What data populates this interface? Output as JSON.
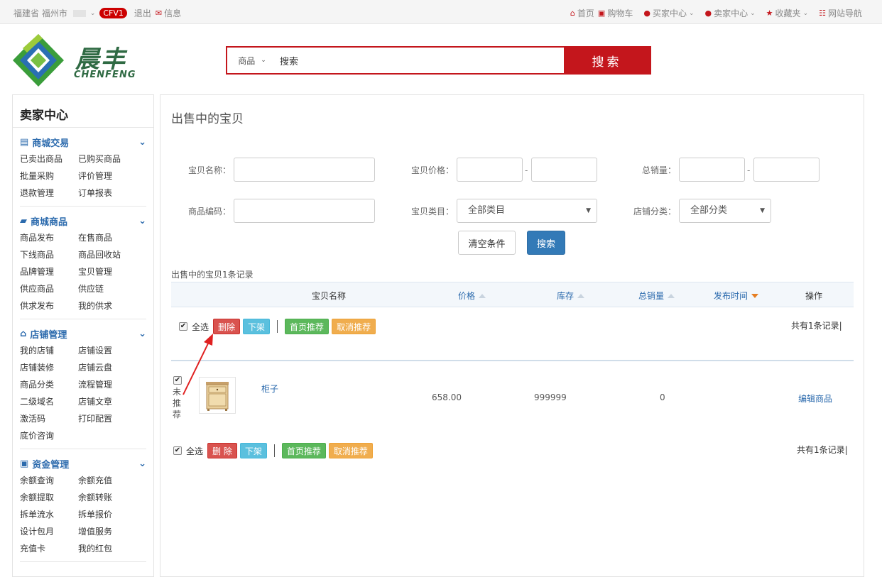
{
  "topbar": {
    "location": "福建省 福州市",
    "user_badge": "CFV1",
    "logout": "退出",
    "messages": "信息",
    "nav": [
      {
        "label": "首页",
        "icon": "home-icon"
      },
      {
        "label": "购物车",
        "icon": "cart-icon"
      },
      {
        "label": "买家中心",
        "icon": "user-icon"
      },
      {
        "label": "卖家中心",
        "icon": "user-icon"
      },
      {
        "label": "收藏夹",
        "icon": "star-icon"
      },
      {
        "label": "网站导航",
        "icon": "sitemap-icon"
      }
    ]
  },
  "header": {
    "brand_cn": "晨丰",
    "brand_en": "CHENFENG",
    "search": {
      "category": "商品",
      "value": "搜索",
      "button": "搜索"
    }
  },
  "sidebar": {
    "title": "卖家中心",
    "sections": [
      {
        "title": "商城交易",
        "icon": "list-icon",
        "items": [
          "已卖出商品",
          "已购买商品",
          "批量采购",
          "评价管理",
          "退款管理",
          "订单报表"
        ]
      },
      {
        "title": "商城商品",
        "icon": "truck-icon",
        "items": [
          "商品发布",
          "在售商品",
          "下线商品",
          "商品回收站",
          "品牌管理",
          "宝贝管理",
          "供应商品",
          "供应链",
          "供求发布",
          "我的供求"
        ]
      },
      {
        "title": "店铺管理",
        "icon": "home-icon",
        "items": [
          "我的店铺",
          "店铺设置",
          "店铺装修",
          "店铺云盘",
          "商品分类",
          "流程管理",
          "二级域名",
          "店铺文章",
          "激活码",
          "打印配置",
          "底价咨询"
        ]
      },
      {
        "title": "资金管理",
        "icon": "money-icon",
        "items": [
          "余额查询",
          "余额充值",
          "余额提取",
          "余额转账",
          "拆单流水",
          "拆单报价",
          "设计包月",
          "增值服务",
          "充值卡",
          "我的红包"
        ]
      }
    ]
  },
  "main": {
    "title": "出售中的宝贝",
    "filters": {
      "name_label": "宝贝名称：",
      "price_label": "宝贝价格：",
      "sales_label": "总销量：",
      "code_label": "商品编码：",
      "category_label": "宝贝类目：",
      "category_value": "全部类目",
      "shop_cat_label": "店铺分类：",
      "shop_cat_value": "全部分类",
      "dash": "-"
    },
    "clear_button": "清空条件",
    "search_button": "搜索",
    "record_count": "出售中的宝贝1条记录",
    "columns": {
      "name": "宝贝名称",
      "price": "价格",
      "stock": "库存",
      "sales": "总销量",
      "time": "发布时间",
      "ops": "操作"
    },
    "bulk": {
      "select_all": "全选",
      "delete_top": "删除",
      "delete_bottom": "删 除",
      "offline": "下架",
      "recommend": "首页推荐",
      "unrecommend": "取消推荐",
      "total": "共有1条记录|"
    },
    "rows": [
      {
        "status": "未推荐",
        "name": "柜子",
        "price": "658.00",
        "stock": "999999",
        "sales": "0",
        "action": "编辑商品"
      }
    ]
  }
}
